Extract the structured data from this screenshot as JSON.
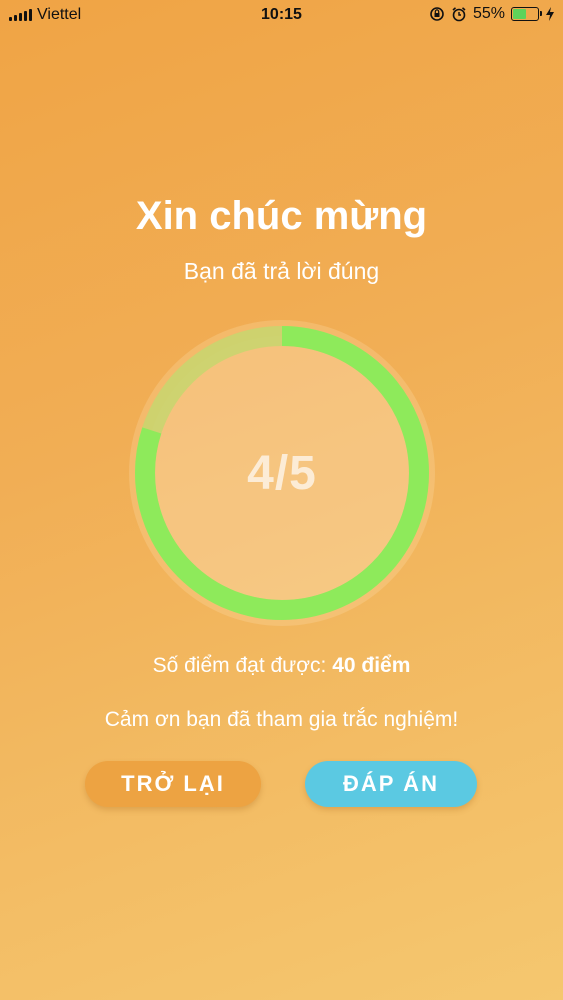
{
  "status_bar": {
    "carrier": "Viettel",
    "time": "10:15",
    "battery_percent": "55%",
    "battery_level": 0.55,
    "icons": [
      "signal-icon",
      "orientation-lock-icon",
      "alarm-icon",
      "battery-icon",
      "charging-icon"
    ]
  },
  "result": {
    "title": "Xin chúc mừng",
    "subtitle": "Bạn đã trả lời đúng",
    "score_text": "4/5",
    "correct": 4,
    "total": 5,
    "points_label": "Số điểm đạt được:",
    "points_value": "40 điểm",
    "thanks": "Cảm ơn bạn đã tham gia trắc nghiệm!"
  },
  "buttons": {
    "back": "TRỞ LẠI",
    "answer": "ĐÁP ÁN"
  },
  "colors": {
    "progress": "#8eea5b",
    "progress_remaining": "#c7d66f",
    "back_button": "#eda342",
    "answer_button": "#5bc9e2"
  }
}
